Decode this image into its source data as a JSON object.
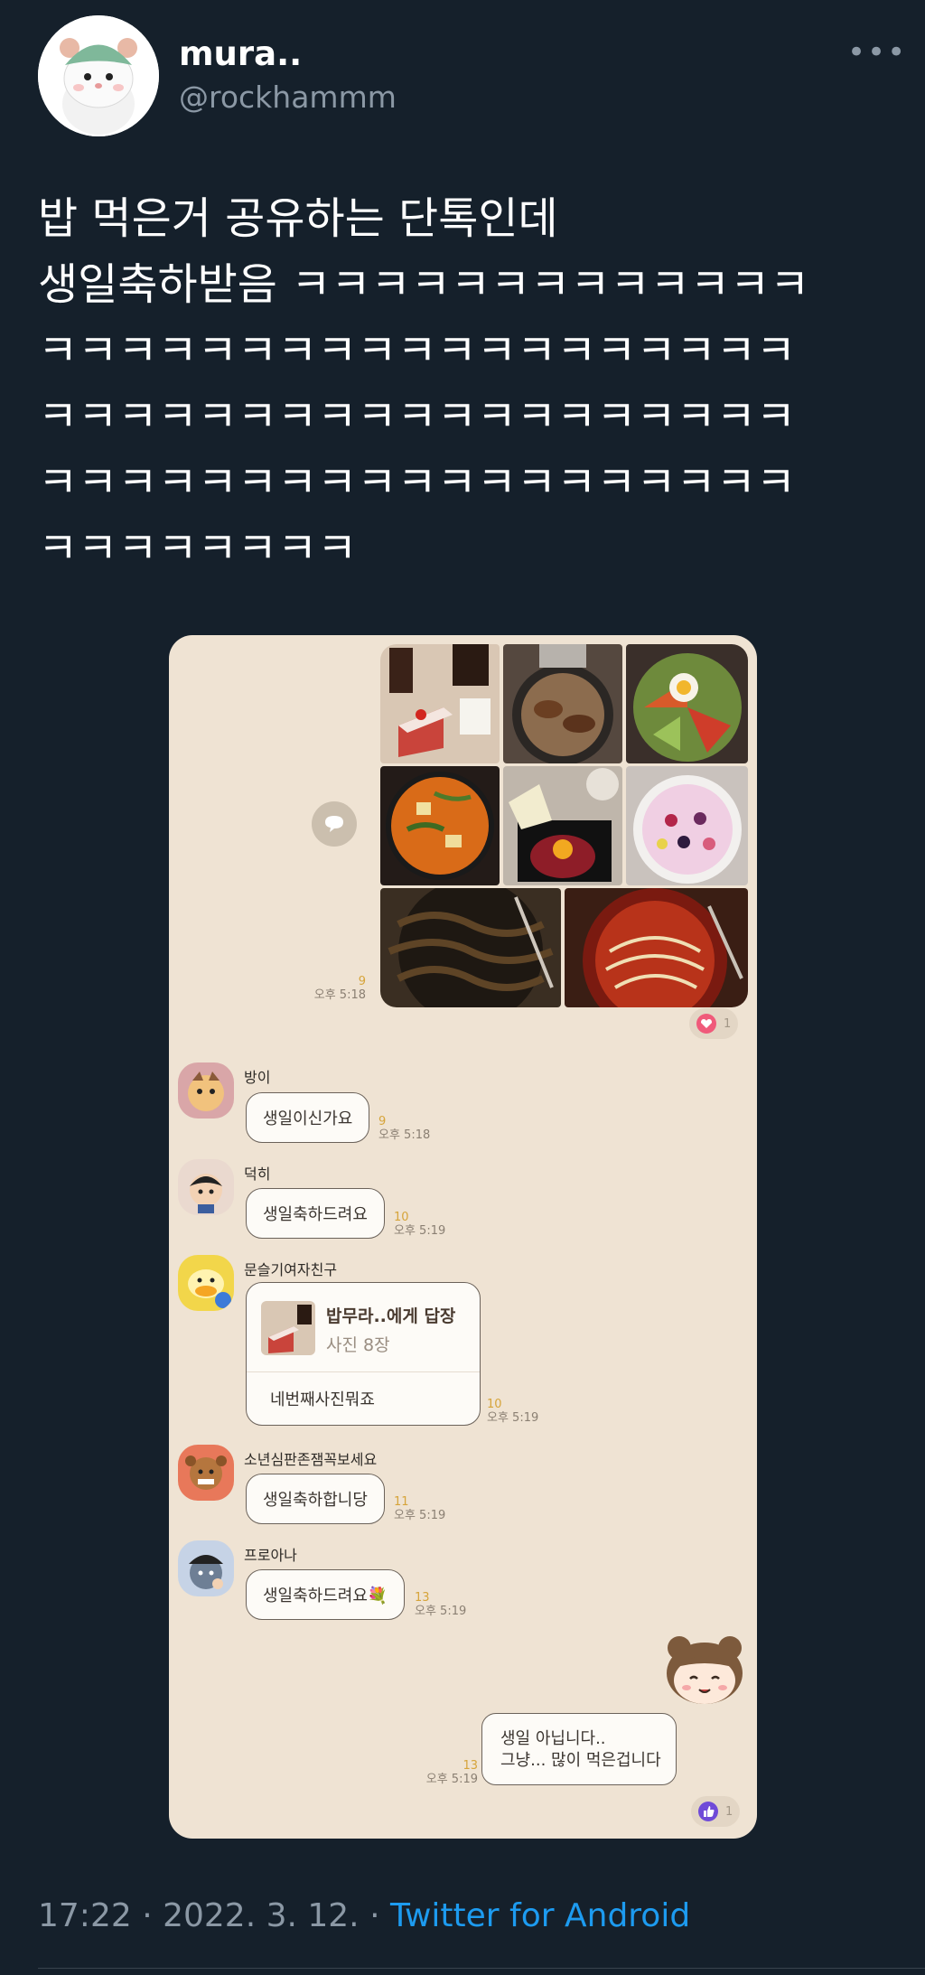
{
  "author": {
    "display_name": "mura..",
    "handle": "@rockhammm"
  },
  "more_label": "•••",
  "tweet": {
    "text": "밥 먹은거 공유하는 단톡인데\n생일축하받음 ㅋㅋㅋㅋㅋㅋㅋㅋㅋㅋㅋㅋㅋ\nㅋㅋㅋㅋㅋㅋㅋㅋㅋㅋㅋㅋㅋㅋㅋㅋㅋㅋㅋ\nㅋㅋㅋㅋㅋㅋㅋㅋㅋㅋㅋㅋㅋㅋㅋㅋㅋㅋㅋ\nㅋㅋㅋㅋㅋㅋㅋㅋㅋㅋㅋㅋㅋㅋㅋㅋㅋㅋㅋ\nㅋㅋㅋㅋㅋㅋㅋㅋ"
  },
  "chat": {
    "photo_post": {
      "unread": "9",
      "time": "오후 5:18",
      "reaction_count": "1"
    },
    "messages": [
      {
        "sender": "방이",
        "text": "생일이신가요",
        "unread": "9",
        "time": "오후 5:18"
      },
      {
        "sender": "덕히",
        "text": "생일축하드려요",
        "unread": "10",
        "time": "오후 5:19"
      },
      {
        "sender": "문슬기여자친구",
        "unread": "10",
        "time": "오후 5:19"
      },
      {
        "sender": "소년심판존잼꼭보세요",
        "text": "생일축하합니당",
        "unread": "11",
        "time": "오후 5:19"
      },
      {
        "sender": "프로아나",
        "text": "생일축하드려요💐",
        "unread": "13",
        "time": "오후 5:19"
      }
    ],
    "reply": {
      "title": "밥무라..에게 답장",
      "subtitle": "사진 8장",
      "body": "네번째사진뭐죠"
    },
    "own_message": {
      "line1": "생일 아닙니다..",
      "line2": "그냥... 많이 먹은겁니다",
      "unread": "13",
      "time": "오후 5:19",
      "reaction_count": "1"
    }
  },
  "footer": {
    "time_date": "17:22 · 2022. 3. 12. · ",
    "source": "Twitter for Android"
  }
}
